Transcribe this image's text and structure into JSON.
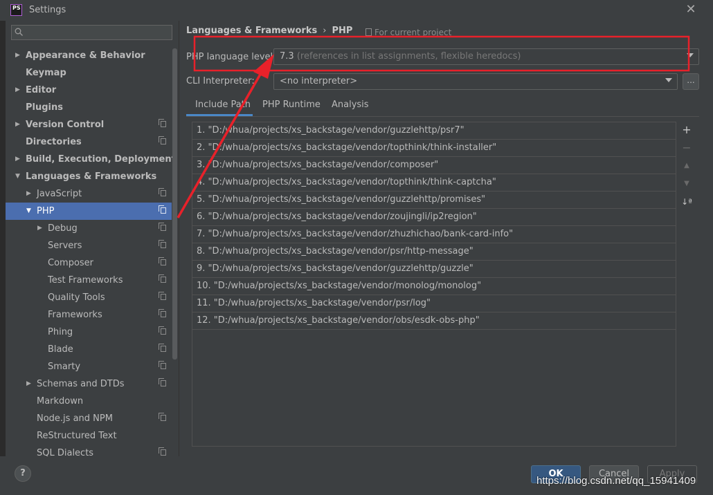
{
  "window": {
    "title": "Settings",
    "logo_text": "PS",
    "close_glyph": "✕"
  },
  "sidebar": {
    "search_placeholder": "",
    "items": [
      {
        "label": "Appearance & Behavior",
        "level": 0,
        "arrow": "right",
        "bold": true,
        "copy": false
      },
      {
        "label": "Keymap",
        "level": 0,
        "arrow": "none",
        "bold": true,
        "copy": false
      },
      {
        "label": "Editor",
        "level": 0,
        "arrow": "right",
        "bold": true,
        "copy": false
      },
      {
        "label": "Plugins",
        "level": 0,
        "arrow": "none",
        "bold": true,
        "copy": false
      },
      {
        "label": "Version Control",
        "level": 0,
        "arrow": "right",
        "bold": true,
        "copy": true
      },
      {
        "label": "Directories",
        "level": 0,
        "arrow": "none",
        "bold": true,
        "copy": true
      },
      {
        "label": "Build, Execution, Deployment",
        "level": 0,
        "arrow": "right",
        "bold": true,
        "copy": false
      },
      {
        "label": "Languages & Frameworks",
        "level": 0,
        "arrow": "down",
        "bold": true,
        "copy": false
      },
      {
        "label": "JavaScript",
        "level": 1,
        "arrow": "right",
        "bold": false,
        "copy": true
      },
      {
        "label": "PHP",
        "level": 1,
        "arrow": "down",
        "bold": false,
        "copy": true,
        "selected": true
      },
      {
        "label": "Debug",
        "level": 2,
        "arrow": "right",
        "bold": false,
        "copy": true
      },
      {
        "label": "Servers",
        "level": 2,
        "arrow": "none",
        "bold": false,
        "copy": true
      },
      {
        "label": "Composer",
        "level": 2,
        "arrow": "none",
        "bold": false,
        "copy": true
      },
      {
        "label": "Test Frameworks",
        "level": 2,
        "arrow": "none",
        "bold": false,
        "copy": true
      },
      {
        "label": "Quality Tools",
        "level": 2,
        "arrow": "none",
        "bold": false,
        "copy": true
      },
      {
        "label": "Frameworks",
        "level": 2,
        "arrow": "none",
        "bold": false,
        "copy": true
      },
      {
        "label": "Phing",
        "level": 2,
        "arrow": "none",
        "bold": false,
        "copy": true
      },
      {
        "label": "Blade",
        "level": 2,
        "arrow": "none",
        "bold": false,
        "copy": true
      },
      {
        "label": "Smarty",
        "level": 2,
        "arrow": "none",
        "bold": false,
        "copy": true
      },
      {
        "label": "Schemas and DTDs",
        "level": 1,
        "arrow": "right",
        "bold": false,
        "copy": true
      },
      {
        "label": "Markdown",
        "level": 1,
        "arrow": "none",
        "bold": false,
        "copy": false
      },
      {
        "label": "Node.js and NPM",
        "level": 1,
        "arrow": "none",
        "bold": false,
        "copy": true
      },
      {
        "label": "ReStructured Text",
        "level": 1,
        "arrow": "none",
        "bold": false,
        "copy": false
      },
      {
        "label": "SQL Dialects",
        "level": 1,
        "arrow": "none",
        "bold": false,
        "copy": true
      }
    ]
  },
  "main": {
    "breadcrumb": [
      "Languages & Frameworks",
      "PHP"
    ],
    "breadcrumb_sep": "›",
    "for_project": "For current project",
    "language_level": {
      "label": "PHP language level:",
      "value": "7.3",
      "hint": "(references in list assignments, flexible heredocs)"
    },
    "cli_interpreter": {
      "label": "CLI Interpreter:",
      "value": "<no interpreter>",
      "more": "..."
    },
    "tabs": [
      {
        "label": "Include Path",
        "active": true
      },
      {
        "label": "PHP Runtime",
        "active": false
      },
      {
        "label": "Analysis",
        "active": false
      }
    ],
    "include_paths": [
      "1. \"D:/whua/projects/xs_backstage/vendor/guzzlehttp/psr7\"",
      "2. \"D:/whua/projects/xs_backstage/vendor/topthink/think-installer\"",
      "3. \"D:/whua/projects/xs_backstage/vendor/composer\"",
      "4. \"D:/whua/projects/xs_backstage/vendor/topthink/think-captcha\"",
      "5. \"D:/whua/projects/xs_backstage/vendor/guzzlehttp/promises\"",
      "6. \"D:/whua/projects/xs_backstage/vendor/zoujingli/ip2region\"",
      "7. \"D:/whua/projects/xs_backstage/vendor/zhuzhichao/bank-card-info\"",
      "8. \"D:/whua/projects/xs_backstage/vendor/psr/http-message\"",
      "9. \"D:/whua/projects/xs_backstage/vendor/guzzlehttp/guzzle\"",
      "10. \"D:/whua/projects/xs_backstage/vendor/monolog/monolog\"",
      "11. \"D:/whua/projects/xs_backstage/vendor/psr/log\"",
      "12. \"D:/whua/projects/xs_backstage/vendor/obs/esdk-obs-php\""
    ],
    "tools": {
      "add": "+",
      "remove": "−",
      "up": "▲",
      "down": "▼",
      "sort": "↓ª"
    }
  },
  "footer": {
    "help": "?",
    "ok": "OK",
    "cancel": "Cancel",
    "apply": "Apply"
  },
  "watermark": "https://blog.csdn.net/qq_15941409",
  "colors": {
    "background": "#3c3f41",
    "selection": "#4b6eaf",
    "annotation": "#e8212a",
    "ok_button": "#365880"
  }
}
